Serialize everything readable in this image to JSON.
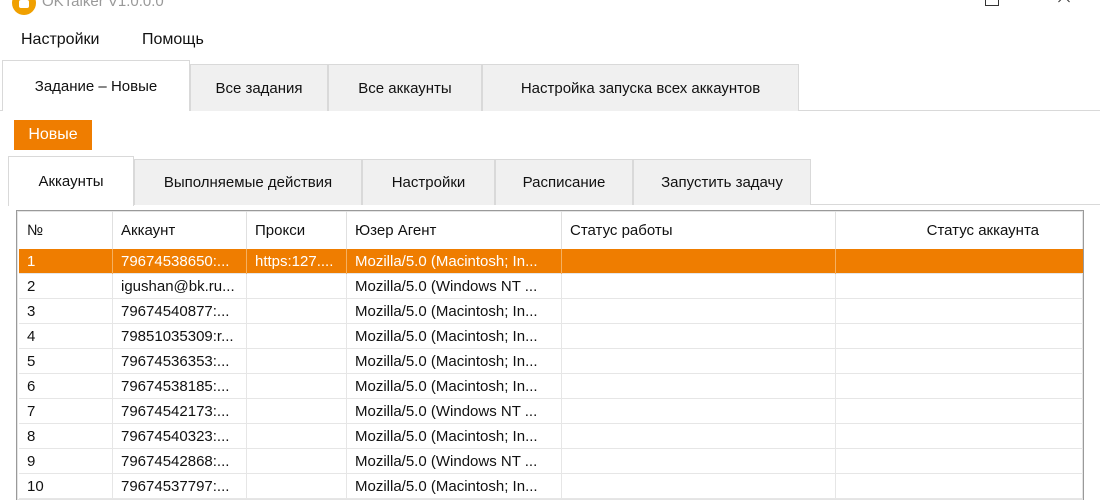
{
  "window": {
    "title": "OKTalker V1.0.0.0"
  },
  "menu": {
    "items": [
      "Настройки",
      "Помощь"
    ]
  },
  "main_tabs": [
    {
      "label": "Задание – Новые",
      "active": true
    },
    {
      "label": "Все задания",
      "active": false
    },
    {
      "label": "Все аккаунты",
      "active": false
    },
    {
      "label": "Настройка запуска всех аккаунтов",
      "active": false
    }
  ],
  "task_badge": "Новые",
  "sub_tabs": [
    {
      "label": "Аккаунты",
      "active": true
    },
    {
      "label": "Выполняемые действия",
      "active": false
    },
    {
      "label": "Настройки",
      "active": false
    },
    {
      "label": "Расписание",
      "active": false
    },
    {
      "label": "Запустить задачу",
      "active": false
    }
  ],
  "grid": {
    "columns": [
      "№",
      "Аккаунт",
      "Прокси",
      "Юзер Агент",
      "Статус работы",
      "Статус аккаунта"
    ],
    "selected_row": 0,
    "rows": [
      [
        "1",
        "79674538650:...",
        "https:127....",
        "Mozilla/5.0 (Macintosh; In...",
        "",
        ""
      ],
      [
        "2",
        "igushan@bk.ru...",
        "",
        "Mozilla/5.0 (Windows NT ...",
        "",
        ""
      ],
      [
        "3",
        "79674540877:...",
        "",
        "Mozilla/5.0 (Macintosh; In...",
        "",
        ""
      ],
      [
        "4",
        "79851035309:r...",
        "",
        "Mozilla/5.0 (Macintosh; In...",
        "",
        ""
      ],
      [
        "5",
        "79674536353:...",
        "",
        "Mozilla/5.0 (Macintosh; In...",
        "",
        ""
      ],
      [
        "6",
        "79674538185:...",
        "",
        "Mozilla/5.0 (Macintosh; In...",
        "",
        ""
      ],
      [
        "7",
        "79674542173:...",
        "",
        "Mozilla/5.0 (Windows NT ...",
        "",
        ""
      ],
      [
        "8",
        "79674540323:...",
        "",
        "Mozilla/5.0 (Macintosh; In...",
        "",
        ""
      ],
      [
        "9",
        "79674542868:...",
        "",
        "Mozilla/5.0 (Windows NT ...",
        "",
        ""
      ],
      [
        "10",
        "79674537797:...",
        "",
        "Mozilla/5.0 (Macintosh; In...",
        "",
        ""
      ]
    ]
  },
  "colors": {
    "accent": "#ef7d00"
  }
}
